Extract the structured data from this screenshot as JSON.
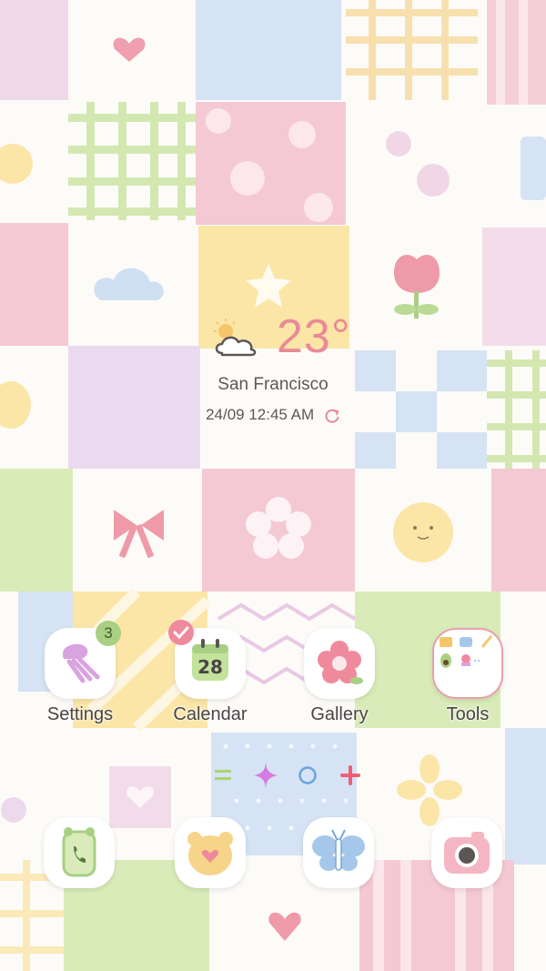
{
  "weather": {
    "temperature": "23°",
    "city": "San Francisco",
    "datetime": "24/09 12:45 AM",
    "icon": "partly-cloudy-icon"
  },
  "apps": [
    {
      "label": "Settings",
      "icon": "comb-icon",
      "badge": "3"
    },
    {
      "label": "Calendar",
      "icon": "calendar-icon",
      "date": "28"
    },
    {
      "label": "Gallery",
      "icon": "flower-icon"
    },
    {
      "label": "Tools",
      "icon": "tools-folder-icon"
    }
  ],
  "page_indicator": [
    "menu-icon",
    "sparkle-icon",
    "circle-icon",
    "plus-icon"
  ],
  "dock": [
    "phone-icon",
    "bear-icon",
    "butterfly-icon",
    "camera-icon"
  ],
  "colors": {
    "pink": "#f3c6d0",
    "yellow": "#fbe3a6",
    "blue": "#cfe0f2",
    "green": "#d9ebb8",
    "lavender": "#e7d9ee",
    "accent_text": "#e98b95"
  }
}
